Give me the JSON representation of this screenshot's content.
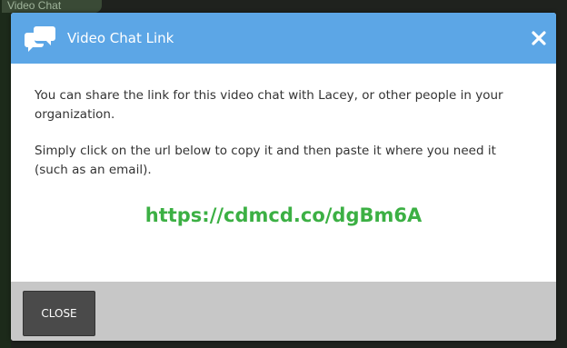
{
  "backdrop": {
    "tab_label": "Video Chat"
  },
  "modal": {
    "title": "Video Chat Link",
    "header_icon": "chat-bubbles-icon",
    "close_icon": "close-icon",
    "body": {
      "paragraph_1": "You can share the link for this video chat with Lacey, or other people in your organization.",
      "paragraph_2": "Simply click on the url below to copy it and then paste it where you need it (such as an email).",
      "link": "https://cdmcd.co/dgBm6A"
    },
    "footer": {
      "close_label": "CLOSE"
    }
  },
  "colors": {
    "header_bg": "#5ca6e6",
    "link": "#3cb044",
    "footer_bg": "#c7c7c7",
    "button_bg": "#4a4a4a"
  }
}
